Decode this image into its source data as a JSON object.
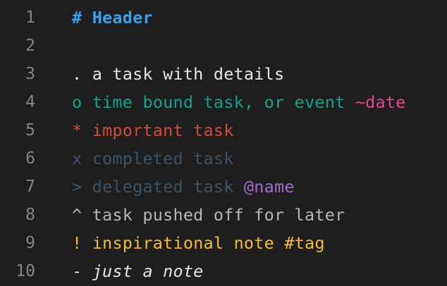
{
  "colors": {
    "background": "#1e1e1e",
    "line_number": "#858585",
    "header": "#3aa0e8",
    "default_text": "#e8e8e8",
    "event_teal": "#13a389",
    "date_pink": "#e5478e",
    "important_red": "#d24a3a",
    "completed_slate": "#3f5263",
    "name_purple": "#a46cc7",
    "pushed_gray": "#b7b7b7",
    "inspiration_yellow": "#f3be2c"
  },
  "lines": [
    {
      "num": "1",
      "segments": [
        {
          "text": "# Header",
          "color": "#3aa0e8",
          "bold": true
        }
      ]
    },
    {
      "num": "2",
      "segments": []
    },
    {
      "num": "3",
      "segments": [
        {
          "text": ". a task with details",
          "color": "#e8e8e8"
        }
      ]
    },
    {
      "num": "4",
      "segments": [
        {
          "text": "o time bound task, or event ",
          "color": "#13a389"
        },
        {
          "text": "~date",
          "color": "#e5478e"
        }
      ]
    },
    {
      "num": "5",
      "segments": [
        {
          "text": "* important task",
          "color": "#d24a3a"
        }
      ]
    },
    {
      "num": "6",
      "segments": [
        {
          "text": "x completed task",
          "color": "#3f5263"
        }
      ]
    },
    {
      "num": "7",
      "segments": [
        {
          "text": "> delegated task ",
          "color": "#3f5263"
        },
        {
          "text": "@name",
          "color": "#a46cc7"
        }
      ]
    },
    {
      "num": "8",
      "segments": [
        {
          "text": "^ task pushed off for later",
          "color": "#b7b7b7"
        }
      ]
    },
    {
      "num": "9",
      "segments": [
        {
          "text": "! inspirational note ",
          "color": "#f3be2c"
        },
        {
          "text": "#tag",
          "color": "#f3be2c"
        }
      ]
    },
    {
      "num": "10",
      "segments": [
        {
          "text": "- ",
          "color": "#e8e8e8"
        },
        {
          "text": "just a note",
          "color": "#e8e8e8",
          "italic": true
        }
      ]
    }
  ]
}
